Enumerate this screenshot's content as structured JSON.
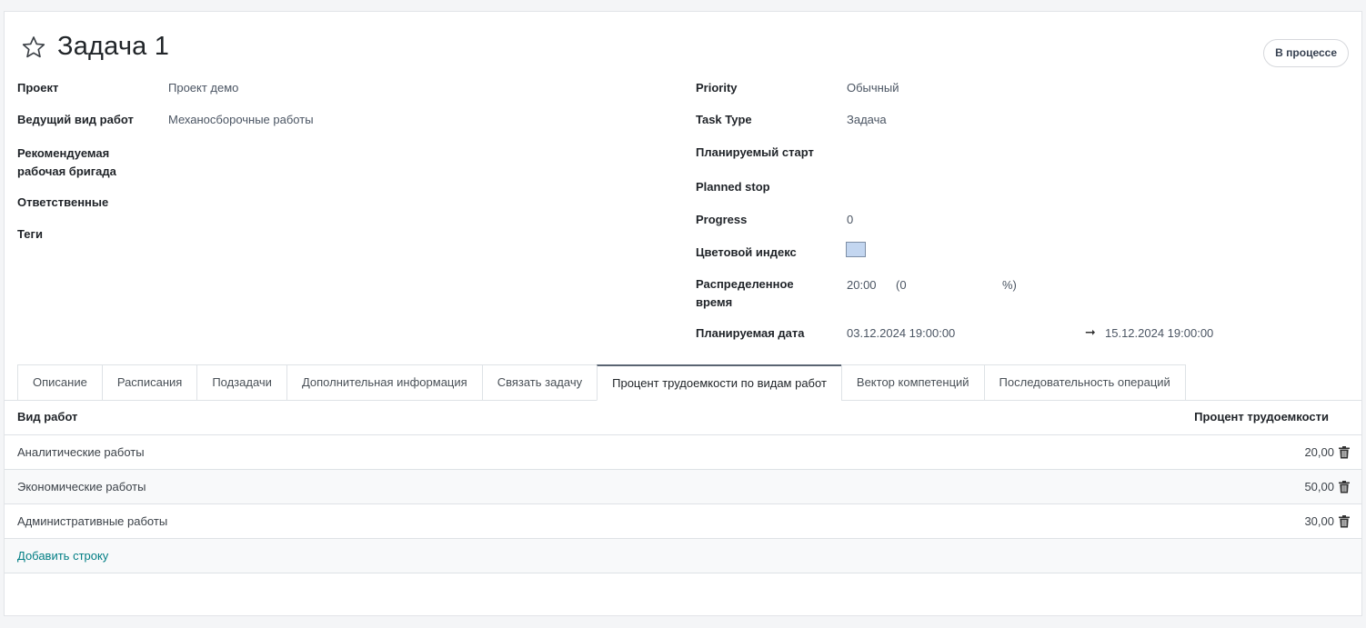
{
  "header": {
    "title": "Задача 1",
    "status_button": "В процессе"
  },
  "left_fields": {
    "project": {
      "label": "Проект",
      "value": "Проект демо"
    },
    "lead_work_type": {
      "label": "Ведущий вид работ",
      "value": "Механосборочные работы"
    },
    "recommended_team": {
      "label_line1": "Рекомендуемая",
      "label_line2": "рабочая бригада",
      "value": ""
    },
    "responsible": {
      "label": "Ответственные",
      "value": ""
    },
    "tags": {
      "label": "Теги",
      "value": ""
    }
  },
  "right_fields": {
    "priority": {
      "label": "Priority",
      "value": "Обычный"
    },
    "task_type": {
      "label": "Task Type",
      "value": "Задача"
    },
    "planned_start": {
      "label": "Планируемый старт",
      "value": ""
    },
    "planned_stop": {
      "label": "Planned stop",
      "value": ""
    },
    "progress": {
      "label": "Progress",
      "value": "0"
    },
    "color_index": {
      "label": "Цветовой индекс",
      "color": "#c3d6f0"
    },
    "allocated_time": {
      "label_line1": "Распределенное",
      "label_line2": "время",
      "value": "20:00",
      "percent_open": "(0",
      "percent_close": "%)"
    },
    "planned_date": {
      "label": "Планируемая дата",
      "start": "03.12.2024 19:00:00",
      "arrow": "➞",
      "end": "15.12.2024 19:00:00"
    }
  },
  "tabs": [
    {
      "label": "Описание"
    },
    {
      "label": "Расписания"
    },
    {
      "label": "Подзадачи"
    },
    {
      "label": "Дополнительная информация"
    },
    {
      "label": "Связать задачу"
    },
    {
      "label": "Процент трудоемкости по видам работ"
    },
    {
      "label": "Вектор компетенций"
    },
    {
      "label": "Последовательность операций"
    }
  ],
  "active_tab": "Процент трудоемкости по видам работ",
  "table": {
    "columns": [
      "Вид работ",
      "Процент трудоемкости"
    ],
    "rows": [
      {
        "name": "Аналитические работы",
        "percent": "20,00"
      },
      {
        "name": "Экономические работы",
        "percent": "50,00"
      },
      {
        "name": "Административные работы",
        "percent": "30,00"
      }
    ],
    "add_row_label": "Добавить строку"
  }
}
